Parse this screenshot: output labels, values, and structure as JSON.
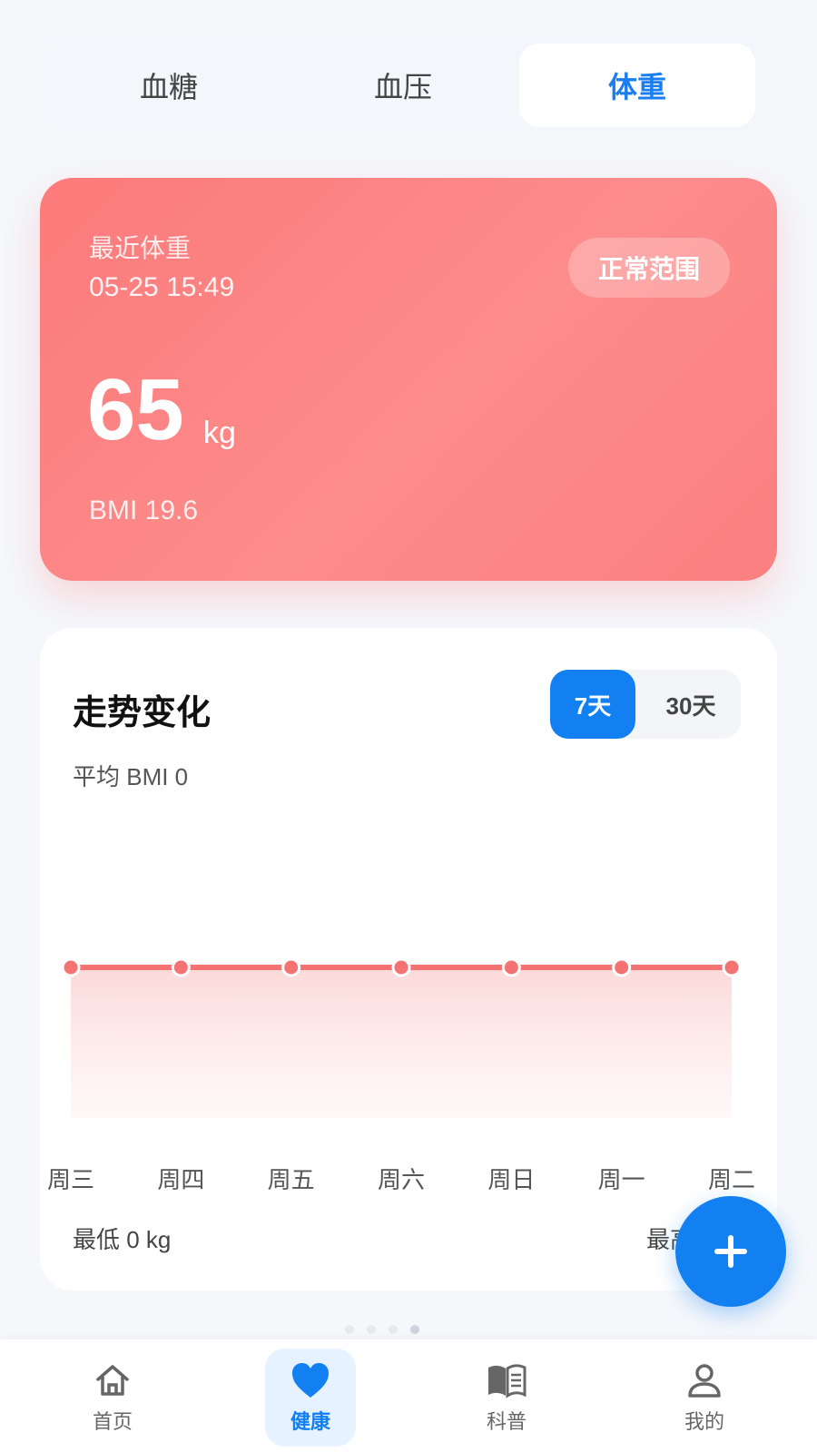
{
  "tabs": [
    {
      "label": "血糖",
      "active": false
    },
    {
      "label": "血压",
      "active": false
    },
    {
      "label": "体重",
      "active": true
    }
  ],
  "weight_card": {
    "label": "最近体重",
    "timestamp": "05-25 15:49",
    "status_badge": "正常范围",
    "value": "65",
    "unit": "kg",
    "bmi": "BMI 19.6",
    "colors": {
      "start": "#fc7a7a",
      "end": "#fb7f80"
    }
  },
  "trend": {
    "title": "走势变化",
    "range_options": [
      "7天",
      "30天"
    ],
    "selected_range": "7天",
    "avg_bmi": "平均 BMI 0",
    "min": "最低 0 kg",
    "max_partial": "最高"
  },
  "chart_data": {
    "type": "area",
    "categories": [
      "周三",
      "周四",
      "周五",
      "周六",
      "周日",
      "周一",
      "周二"
    ],
    "series": [
      {
        "values": [
          0,
          0,
          0,
          0,
          0,
          0,
          0
        ]
      }
    ],
    "color": "#f47272"
  },
  "fab": {
    "icon": "plus-icon"
  },
  "bottom_nav": [
    {
      "label": "首页",
      "icon": "home-icon",
      "active": false
    },
    {
      "label": "健康",
      "icon": "heart-icon",
      "active": true
    },
    {
      "label": "科普",
      "icon": "book-icon",
      "active": false
    },
    {
      "label": "我的",
      "icon": "user-icon",
      "active": false
    }
  ],
  "accent_color": "#1380f2"
}
